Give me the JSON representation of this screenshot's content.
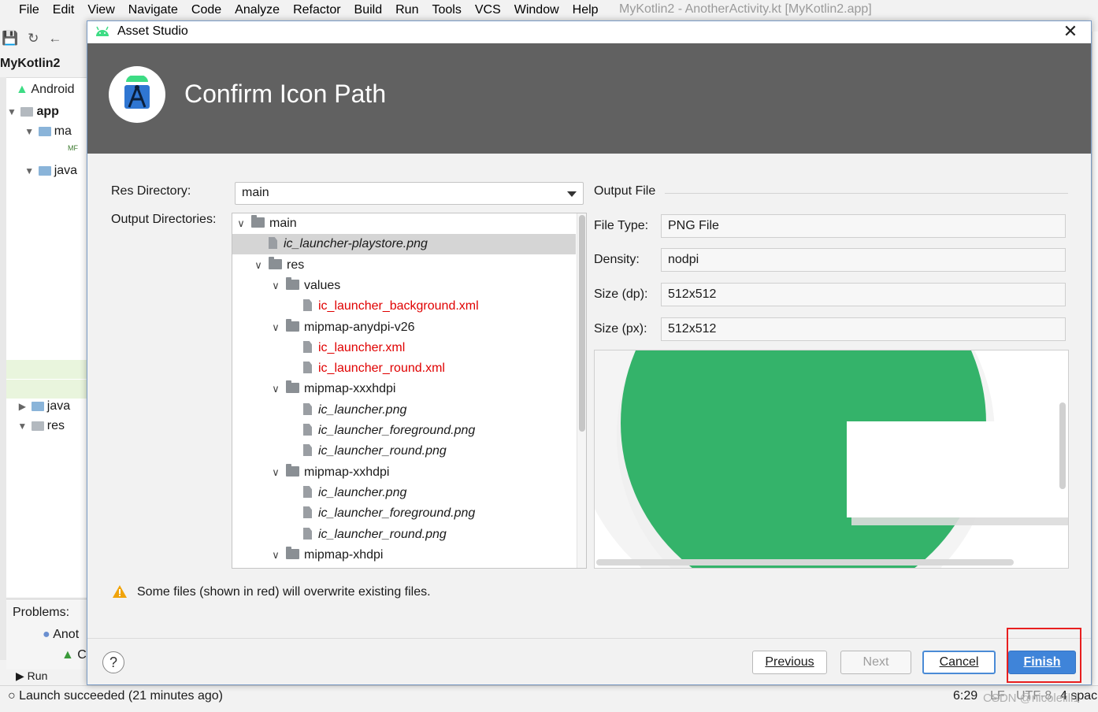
{
  "ide": {
    "menu": [
      "File",
      "Edit",
      "View",
      "Navigate",
      "Code",
      "Analyze",
      "Refactor",
      "Build",
      "Run",
      "Tools",
      "VCS",
      "Window",
      "Help"
    ],
    "window_title": "MyKotlin2 - AnotherActivity.kt [MyKotlin2.app]",
    "breadcrumb": "MyKotlin2",
    "project_view": "Android",
    "tree": [
      {
        "label": "app",
        "level": 0
      },
      {
        "label": "ma",
        "level": 1
      },
      {
        "label": "MF",
        "level": 2
      },
      {
        "label": "java",
        "level": 1
      },
      {
        "label": "java",
        "level": 1
      },
      {
        "label": "res",
        "level": 1
      }
    ],
    "problems_label": "Problems:",
    "problem_item_1": "Anot",
    "problem_item_2": "C",
    "run_label": "Run",
    "status_message": "Launch succeeded (21 minutes ago)",
    "caret_position": "6:29",
    "line_ending": "LF",
    "encoding": "UTF-8",
    "indent": "4 spac",
    "watermark": "CSDN @nicolelili1"
  },
  "dialog": {
    "title": "Asset Studio",
    "heading": "Confirm Icon Path",
    "res_directory_label": "Res Directory:",
    "res_directory_value": "main",
    "output_directories_label": "Output Directories:",
    "output_tree": [
      {
        "label": "main",
        "type": "folder",
        "level": 0,
        "expanded": true
      },
      {
        "label": "ic_launcher-playstore.png",
        "type": "file",
        "level": 1,
        "selected": true,
        "overwrite": false
      },
      {
        "label": "res",
        "type": "folder",
        "level": 1,
        "expanded": true
      },
      {
        "label": "values",
        "type": "folder",
        "level": 2,
        "expanded": true
      },
      {
        "label": "ic_launcher_background.xml",
        "type": "file",
        "level": 3,
        "overwrite": true
      },
      {
        "label": "mipmap-anydpi-v26",
        "type": "folder",
        "level": 2,
        "expanded": true
      },
      {
        "label": "ic_launcher.xml",
        "type": "file",
        "level": 3,
        "overwrite": true
      },
      {
        "label": "ic_launcher_round.xml",
        "type": "file",
        "level": 3,
        "overwrite": true
      },
      {
        "label": "mipmap-xxxhdpi",
        "type": "folder",
        "level": 2,
        "expanded": true
      },
      {
        "label": "ic_launcher.png",
        "type": "file",
        "level": 3,
        "overwrite": false
      },
      {
        "label": "ic_launcher_foreground.png",
        "type": "file",
        "level": 3,
        "overwrite": false
      },
      {
        "label": "ic_launcher_round.png",
        "type": "file",
        "level": 3,
        "overwrite": false
      },
      {
        "label": "mipmap-xxhdpi",
        "type": "folder",
        "level": 2,
        "expanded": true
      },
      {
        "label": "ic_launcher.png",
        "type": "file",
        "level": 3,
        "overwrite": false
      },
      {
        "label": "ic_launcher_foreground.png",
        "type": "file",
        "level": 3,
        "overwrite": false
      },
      {
        "label": "ic_launcher_round.png",
        "type": "file",
        "level": 3,
        "overwrite": false
      },
      {
        "label": "mipmap-xhdpi",
        "type": "folder",
        "level": 2,
        "expanded": true
      }
    ],
    "output_file": {
      "header": "Output File",
      "file_type_label": "File Type:",
      "file_type_value": "PNG File",
      "density_label": "Density:",
      "density_value": "nodpi",
      "size_dp_label": "Size (dp):",
      "size_dp_value": "512x512",
      "size_px_label": "Size (px):",
      "size_px_value": "512x512"
    },
    "warning": "Some files (shown in red) will overwrite existing files.",
    "buttons": {
      "help": "?",
      "previous": "Previous",
      "next": "Next",
      "cancel": "Cancel",
      "finish": "Finish"
    }
  },
  "colors": {
    "banner": "#616161",
    "overwrite_text": "#e00000",
    "finish_button": "#3f84d9",
    "android_green": "#3ddc84",
    "preview_green": "#34b36a",
    "highlight_box": "#e81f1f"
  }
}
